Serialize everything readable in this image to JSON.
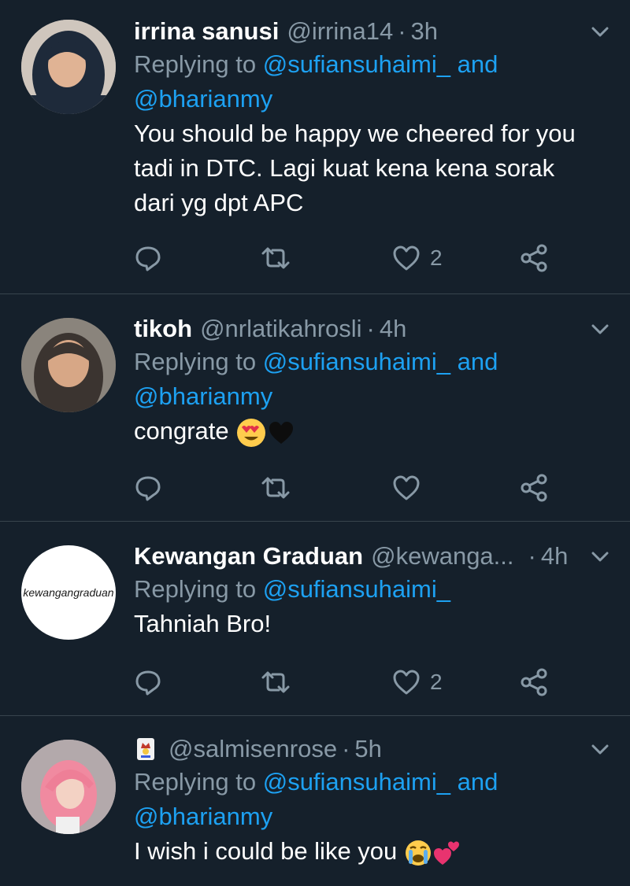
{
  "tweets": [
    {
      "name": "irrina sanusi",
      "handle": "@irrina14",
      "time": "3h",
      "replying_prefix": "Replying to ",
      "replying_users": "@sufiansuhaimi_ and",
      "replying_line2": "@bharianmy",
      "text_lines": [
        "You should be happy we cheered for you",
        "tadi in DTC. Lagi kuat kena kena sorak",
        "dari yg dpt APC"
      ],
      "like_count": "2"
    },
    {
      "name": "tikoh",
      "handle": "@nrlatikahrosli",
      "time": "4h",
      "replying_prefix": "Replying to ",
      "replying_users": "@sufiansuhaimi_ and",
      "replying_line2": "@bharianmy",
      "text_lines": [
        "congrate"
      ],
      "like_count": ""
    },
    {
      "name": "Kewangan Graduan",
      "handle": "@kewanga...",
      "time": "4h",
      "avatar_logo": "kewangangraduan",
      "replying_prefix": "Replying to ",
      "replying_users": "@sufiansuhaimi_",
      "text_lines": [
        "Tahniah Bro!"
      ],
      "like_count": "2"
    },
    {
      "name": "",
      "handle": "@salmisenrose",
      "time": "5h",
      "replying_prefix": "Replying to ",
      "replying_users": "@sufiansuhaimi_ and",
      "replying_line2": "@bharianmy",
      "text_lines": [
        "I wish i could be like you"
      ],
      "like_count": ""
    }
  ],
  "icons": {
    "reply": "reply-icon",
    "retweet": "retweet-icon",
    "like": "heart-icon",
    "share": "share-icon",
    "more": "chevron-down-icon"
  },
  "colors": {
    "background": "#15202b",
    "link": "#1da1f2",
    "muted": "#8899a6",
    "divider": "#38444d"
  }
}
